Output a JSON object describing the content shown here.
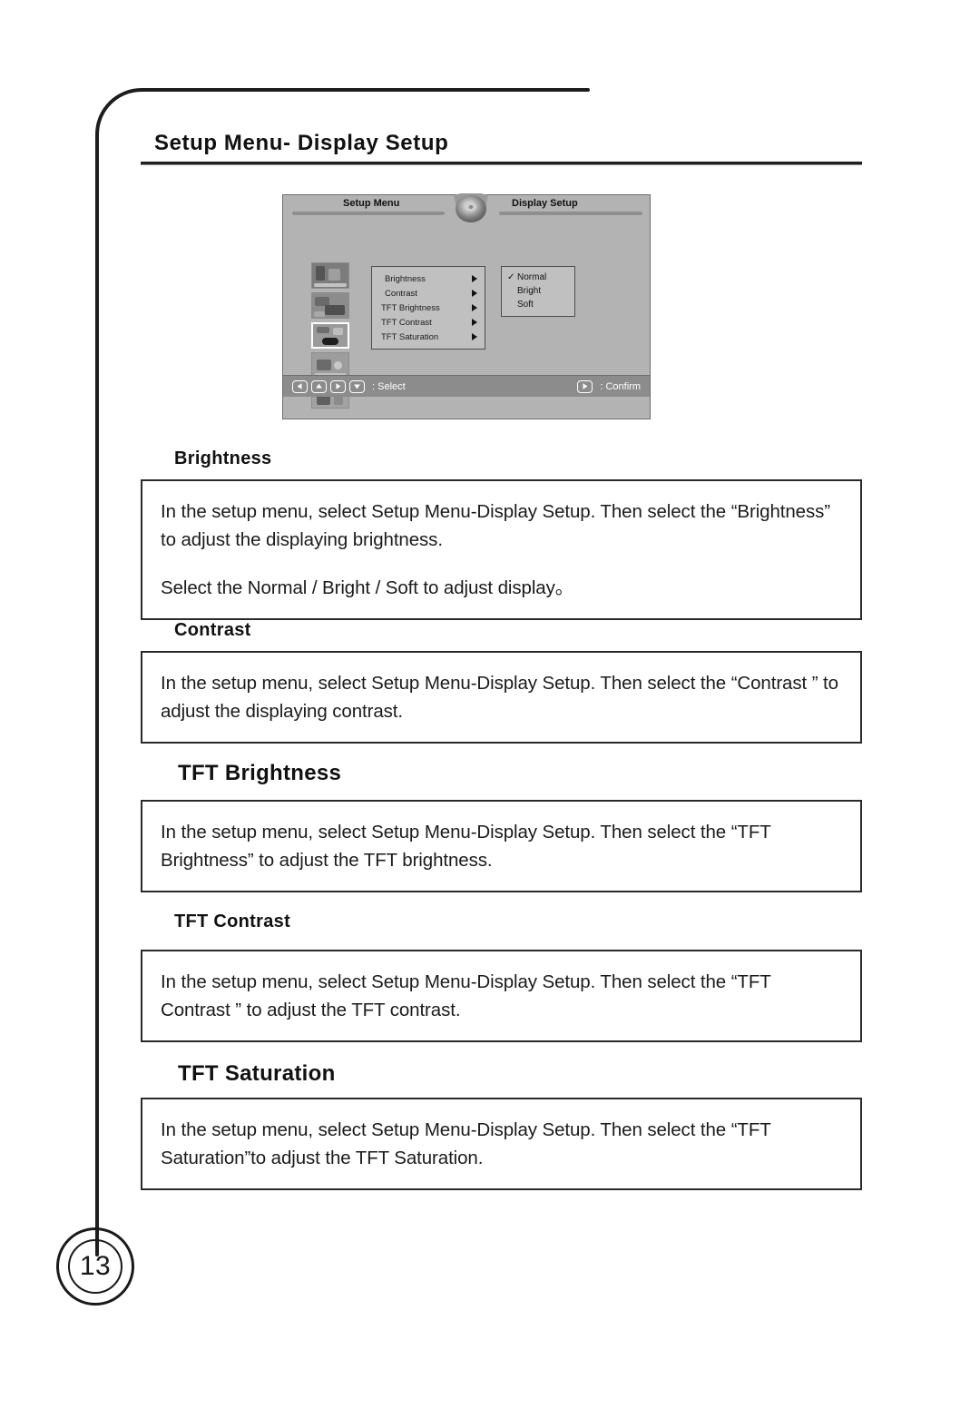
{
  "page": {
    "title": "Setup Menu- Display Setup",
    "number": "13"
  },
  "osd": {
    "header_left": "Setup Menu",
    "header_right": "Display Setup",
    "disc_icon": "disc-icon",
    "menu_items": [
      {
        "label": "Brightness"
      },
      {
        "label": "Contrast"
      },
      {
        "label": "TFT Brightness"
      },
      {
        "label": "TFT Contrast"
      },
      {
        "label": "TFT Saturation"
      }
    ],
    "options": [
      {
        "check": "✓",
        "label": "Normal"
      },
      {
        "check": "",
        "label": "Bright"
      },
      {
        "check": "",
        "label": "Soft"
      }
    ],
    "footer": {
      "select_label": ": Select",
      "confirm_label": ": Confirm",
      "keys": [
        {
          "icon": "arrow-left-icon"
        },
        {
          "icon": "arrow-up-icon"
        },
        {
          "icon": "arrow-right-icon"
        },
        {
          "icon": "arrow-down-icon"
        }
      ],
      "confirm_key": {
        "icon": "play-right-icon"
      }
    },
    "thumbnails": [
      {
        "name": "thumbnail-1",
        "selected": false
      },
      {
        "name": "thumbnail-2",
        "selected": false
      },
      {
        "name": "thumbnail-3",
        "selected": true
      },
      {
        "name": "thumbnail-4",
        "selected": false
      },
      {
        "name": "thumbnail-5",
        "selected": false
      }
    ]
  },
  "sections": [
    {
      "heading": "Brightness",
      "paragraphs": [
        "In the setup menu, select Setup Menu-Display Setup. Then select the “Brightness” to adjust the displaying brightness.",
        "Select the Normal / Bright / Soft to adjust display。"
      ]
    },
    {
      "heading": "Contrast",
      "paragraphs": [
        "In the setup menu, select Setup Menu-Display Setup. Then select the  “Contrast ” to adjust the displaying contrast."
      ]
    },
    {
      "heading": "TFT Brightness",
      "paragraphs": [
        "In the setup menu, select Setup Menu-Display Setup. Then select the “TFT Brightness” to adjust the TFT brightness."
      ]
    },
    {
      "heading": "TFT Contrast",
      "paragraphs": [
        "In the setup menu, select Setup Menu-Display Setup. Then select the “TFT Contrast ” to adjust the TFT contrast."
      ]
    },
    {
      "heading": "TFT Saturation",
      "paragraphs": [
        "In the setup menu, select Setup Menu-Display Setup. Then select the “TFT Saturation”to adjust the TFT Saturation."
      ]
    }
  ],
  "colors": {
    "osd_background": "#b3b3b3",
    "osd_panel": "#c0c0c0",
    "osd_footer": "#8c8c8c",
    "ink": "#1a1a1a"
  }
}
